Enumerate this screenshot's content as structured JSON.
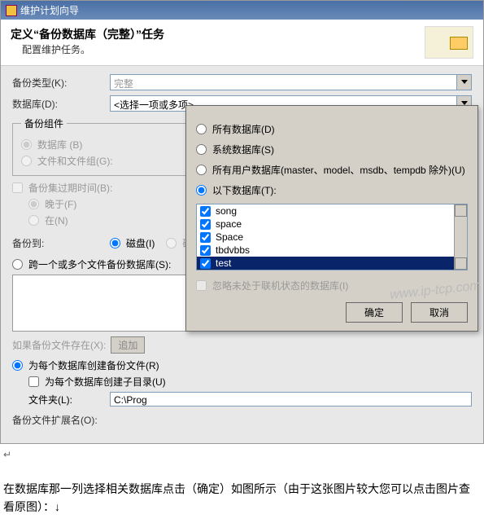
{
  "window_title": "维护计划向导",
  "header": {
    "title": "定义“备份数据库（完整）”任务",
    "subtitle": "配置维护任务。"
  },
  "left": {
    "backup_type_label": "备份类型(K):",
    "backup_type_value": "完整",
    "databases_label": "数据库(D):",
    "databases_value": "<选择一项或多项>",
    "component_legend": "备份组件",
    "component_db": "数据库 (B)",
    "component_fg": "文件和文件组(G):",
    "expire_cb": "备份集过期时间(B):",
    "expire_after": "晚于(F)",
    "expire_on": "在(N)",
    "dest_label": "备份到:",
    "dest_disk": "磁盘(I)",
    "dest_tape": "磁带(P)",
    "span_cb": "跨一个或多个文件备份数据库(S):",
    "if_exists_label": "如果备份文件存在(X):",
    "if_exists_btn": "追加",
    "per_db_radio": "为每个数据库创建备份文件(R)",
    "subdir_cb": "为每个数据库创建子目录(U)",
    "folder_label": "文件夹(L):",
    "folder_value": "C:\\Prog",
    "ext_label": "备份文件扩展名(O):"
  },
  "panel": {
    "opt_all": "所有数据库(D)",
    "opt_sys": "系统数据库(S)",
    "opt_user": "所有用户数据库(master、model、msdb、tempdb 除外)(U)",
    "opt_these": "以下数据库(T):",
    "items": [
      "song",
      "space",
      "Space",
      "tbdvbbs",
      "test"
    ],
    "ignore_offline": "忽略未处于联机状态的数据库(I)",
    "ok": "确定",
    "cancel": "取消"
  },
  "watermark": "www.ip-tcp.com",
  "caption": "在数据库那一列选择相关数据库点击（确定）如图所示（由于这张图片较大您可以点击图片查看原图）：↓",
  "arrow": "↵"
}
